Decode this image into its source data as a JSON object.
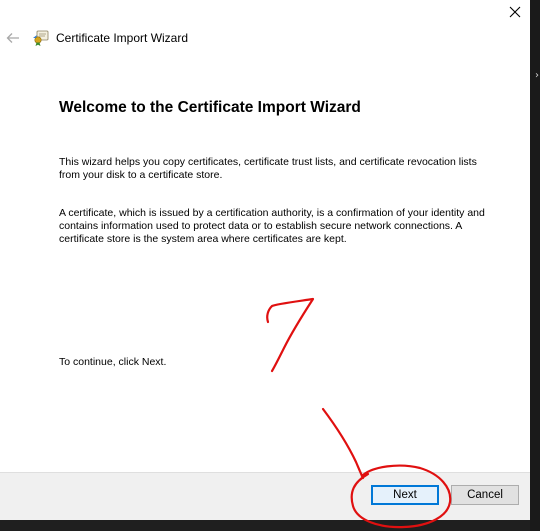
{
  "window": {
    "title": "Certificate Import Wizard",
    "close_glyph": "✕",
    "back_glyph": "←"
  },
  "content": {
    "heading": "Welcome to the Certificate Import Wizard",
    "paragraph1": "This wizard helps you copy certificates, certificate trust lists, and certificate revocation lists from your disk to a certificate store.",
    "paragraph2": "A certificate, which is issued by a certification authority, is a confirmation of your identity and contains information used to protect data or to establish secure network connections. A certificate store is the system area where certificates are kept.",
    "paragraph3": "To continue, click Next."
  },
  "footer": {
    "next_label": "Next",
    "cancel_label": "Cancel"
  },
  "annotation": {
    "step_number": "7",
    "color": "#e01010"
  },
  "colors": {
    "accent": "#0078d7",
    "footer_bg": "#f0f0f0",
    "desktop_bg": "#1f1f1f"
  },
  "icons": {
    "close": "close-icon",
    "back": "back-arrow-icon",
    "app": "certificate-icon"
  }
}
